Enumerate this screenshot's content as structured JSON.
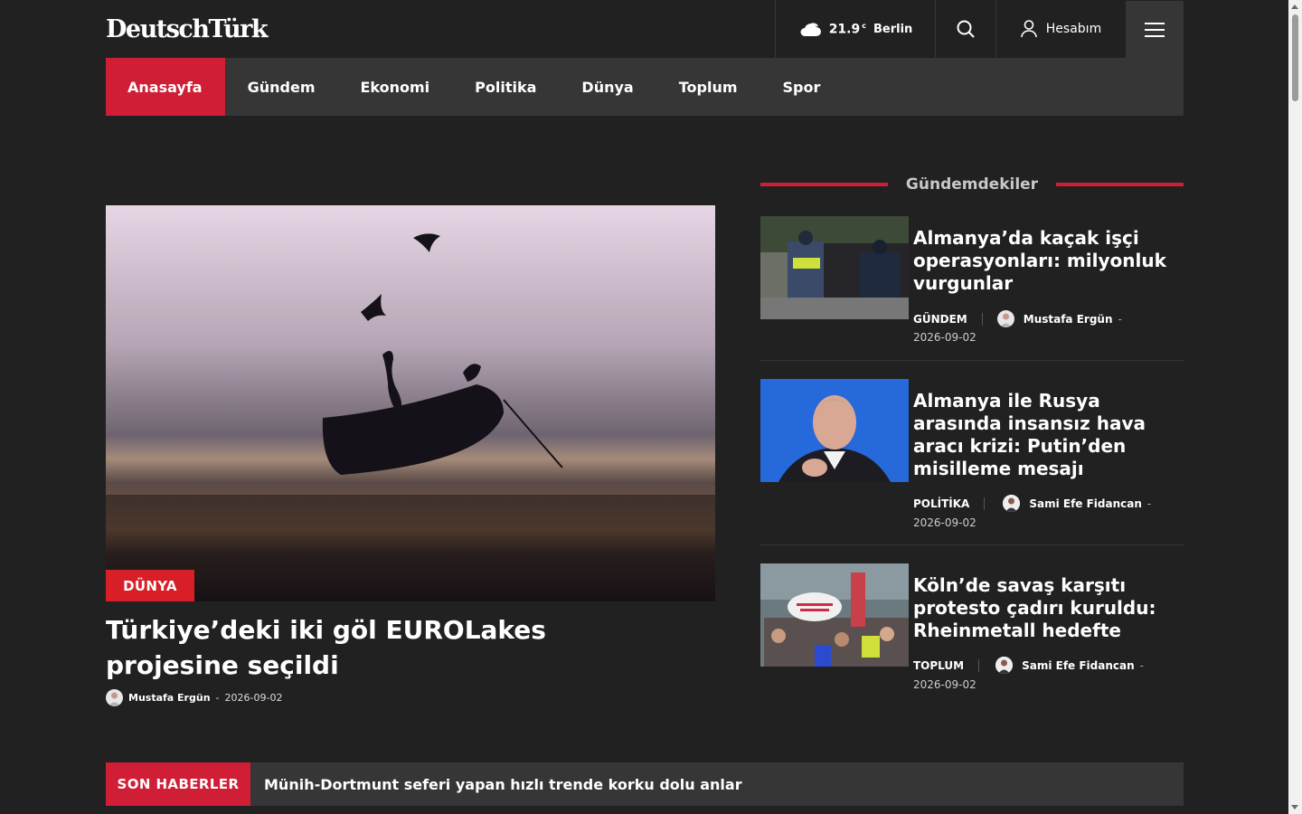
{
  "brand": {
    "logo": "DeutschTürk"
  },
  "header": {
    "weather_temp": "21.9",
    "weather_unit": "c",
    "weather_city": "Berlin",
    "account_label": "Hesabım"
  },
  "nav": {
    "items": [
      {
        "label": "Anasayfa",
        "active": true
      },
      {
        "label": "Gündem"
      },
      {
        "label": "Ekonomi"
      },
      {
        "label": "Politika"
      },
      {
        "label": "Dünya"
      },
      {
        "label": "Toplum"
      },
      {
        "label": "Spor"
      }
    ]
  },
  "hero": {
    "category": "DÜNYA",
    "title": "Türkiye’deki iki göl EUROLakes projesine seçildi",
    "author": "Mustafa Ergün",
    "date": "2026-09-02"
  },
  "sidebar": {
    "heading": "Gündemdekiler",
    "cards": [
      {
        "title": "Almanya’da kaçak işçi operasyonları: milyonluk vurgunlar",
        "category": "GÜNDEM",
        "author": "Mustafa Ergün",
        "date": "2026-09-02"
      },
      {
        "title": "Almanya ile Rusya arasında insansız hava aracı krizi: Putin’den misilleme mesajı",
        "category": "POLİTİKA",
        "author": "Sami Efe Fidancan",
        "date": "2026-09-02"
      },
      {
        "title": "Köln’de savaş karşıtı protesto çadırı kuruldu: Rheinmetall hedefte",
        "category": "TOPLUM",
        "author": "Sami Efe Fidancan",
        "date": "2026-09-02"
      }
    ]
  },
  "ticker": {
    "label": "SON HABERLER",
    "message": "Münih-Dortmunt seferi yapan hızlı trende korku dolu anlar"
  },
  "colors": {
    "accent": "#cf1e36",
    "badge": "#d81f27",
    "bg": "#212121",
    "panel": "#363636"
  }
}
